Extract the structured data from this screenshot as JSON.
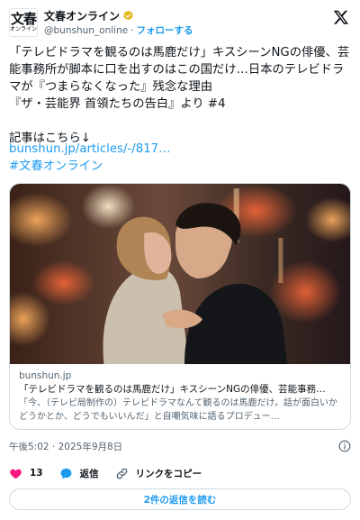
{
  "author": {
    "avatar_big": "文春",
    "avatar_small": "オンライン",
    "display_name": "文春オンライン",
    "handle": "@bunshun_online",
    "separator": "·",
    "follow_label": "フォローする"
  },
  "tweet": {
    "text": "「テレビドラマを観るのは馬鹿だけ」キスシーンNGの俳優、芸能事務所が脚本に口を出すのはこの国だけ…日本のテレビドラマが『つまらなくなった』残念な理由\n『ザ・芸能界 首領たちの告白』より #4\n\n記事はこちら↓",
    "link": "bunshun.jp/articles/-/817…",
    "hashtag": "#文春オンライン"
  },
  "card": {
    "domain": "bunshun.jp",
    "title": "「テレビドラマを観るのは馬鹿だけ」キスシーンNGの俳優、芸能事務…",
    "description": "「今、（テレビ局制作の）テレビドラマなんて観るのは馬鹿だけ。話が面白いかどうかとか、どうでもいいんだ」と自嘲気味に語るプロデュー…"
  },
  "meta": {
    "timestamp": "午後5:02 · 2025年9月8日"
  },
  "actions": {
    "like_count": "13",
    "reply_label": "返信",
    "copy_link_label": "リンクをコピー"
  },
  "replies_button_label": "2件の返信を読む",
  "colors": {
    "accent": "#1d9bf0",
    "like": "#f91880",
    "verified": "#e2b719",
    "muted": "#536471",
    "border": "#cfd9de"
  }
}
